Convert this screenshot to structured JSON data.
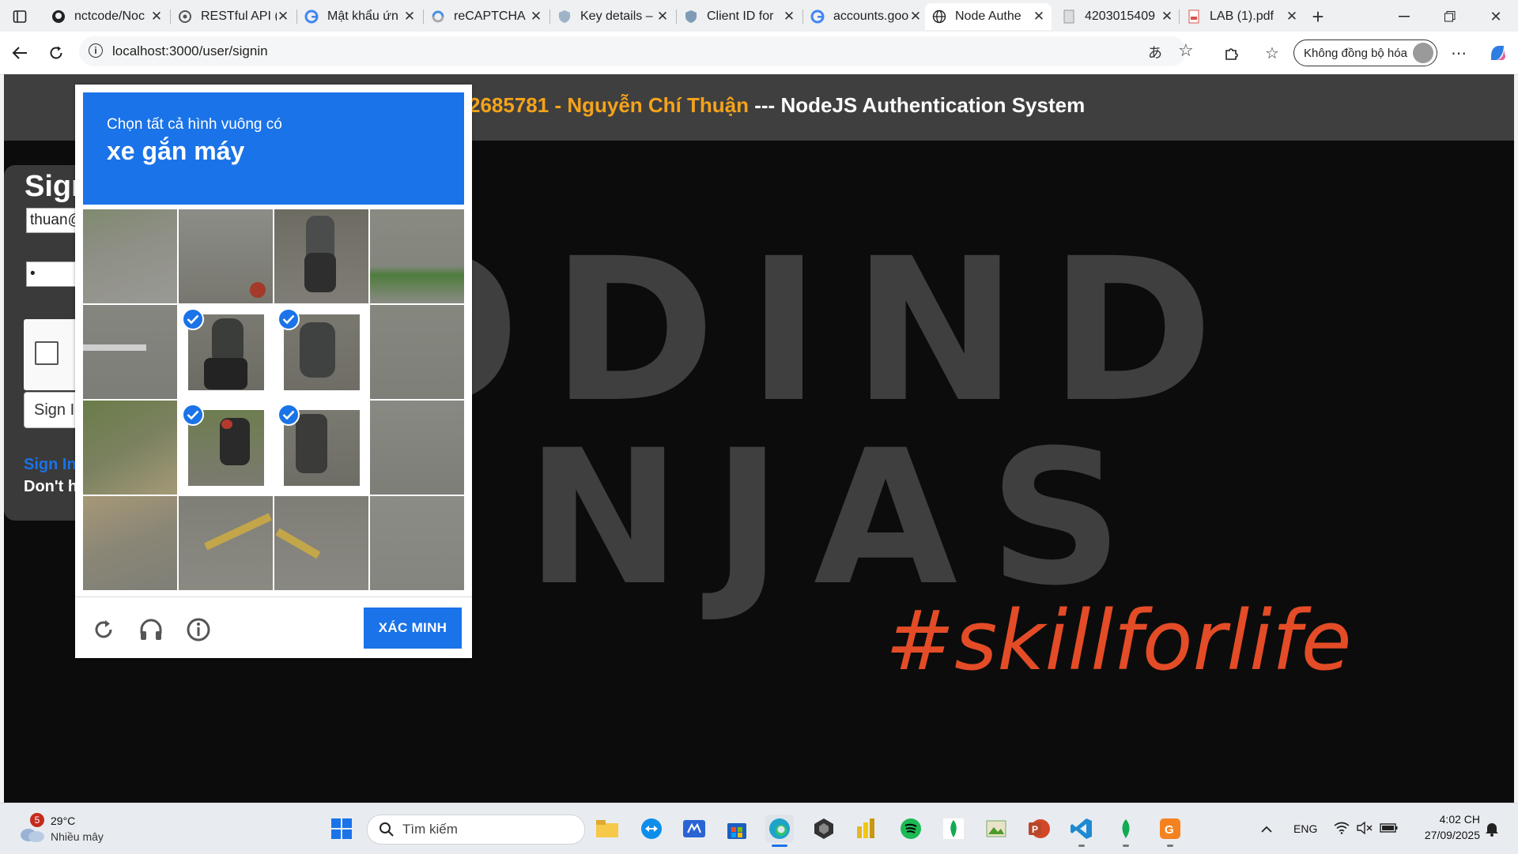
{
  "browser": {
    "tabs": [
      {
        "title": "nctcode/Noc",
        "icon": "github-icon"
      },
      {
        "title": "RESTful API (",
        "icon": "openai-icon"
      },
      {
        "title": "Mật khẩu ứn",
        "icon": "google-icon"
      },
      {
        "title": "reCAPTCHA",
        "icon": "recaptcha-icon"
      },
      {
        "title": "Key details –",
        "icon": "shield-icon"
      },
      {
        "title": "Client ID for",
        "icon": "shield-icon"
      },
      {
        "title": "accounts.goo",
        "icon": "google-icon"
      },
      {
        "title": "Node Authe",
        "icon": "globe-icon",
        "active": true
      },
      {
        "title": "4203015409",
        "icon": "document-icon"
      },
      {
        "title": "LAB (1).pdf",
        "icon": "pdf-icon"
      }
    ],
    "url": "localhost:3000/user/signin",
    "profile_label": "Không đồng bộ hóa"
  },
  "page": {
    "header_id": "2685781",
    "header_sep1": " - ",
    "header_name": "Nguyễn Chí Thuận",
    "header_sep2": " --- ",
    "header_system": "NodeJS Authentication System",
    "bg_line1": "ODIND",
    "bg_line2": "NJAS",
    "bg_tagline": "#skillforlife",
    "signin": {
      "title": "Sign",
      "email_value": "thuan@",
      "password_value": "•",
      "button_label": "Sign I",
      "link_label": "Sign In",
      "footer_text": "Don't h"
    }
  },
  "captcha": {
    "instruction": "Chọn tất cả hình vuông có",
    "target": "xe gắn máy",
    "verify_label": "XÁC MINH",
    "selected_tiles": [
      5,
      6,
      9,
      10
    ]
  },
  "taskbar": {
    "weather_temp": "29°C",
    "weather_desc": "Nhiều mây",
    "weather_badge": "5",
    "search_placeholder": "Tìm kiếm",
    "lang": "ENG",
    "time": "4:02 CH",
    "date": "27/09/2025"
  },
  "colors": {
    "accent": "#1a73e8",
    "header_orange": "#f5a31a",
    "tagline": "#e34c26"
  }
}
